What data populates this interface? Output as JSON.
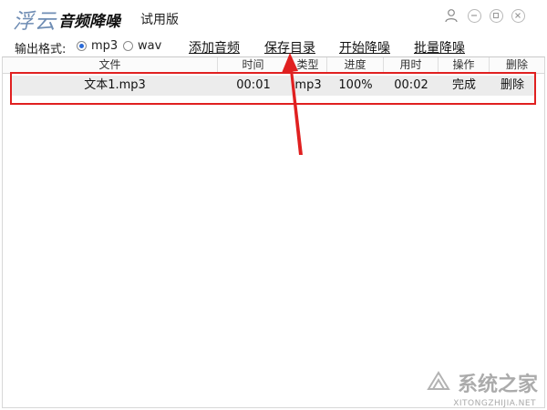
{
  "titlebar": {
    "brand": "浮云",
    "app_name": "音频降噪",
    "edition": "试用版",
    "icons": [
      "user-icon",
      "minimize-icon",
      "restore-icon",
      "close-icon"
    ]
  },
  "toolbar": {
    "format_label": "输出格式:",
    "formats": [
      {
        "label": "mp3",
        "checked": true
      },
      {
        "label": "wav",
        "checked": false
      }
    ],
    "actions": {
      "add_audio": "添加音频",
      "save_dir": "保存目录",
      "start_denoise": "开始降噪",
      "batch_denoise": "批量降噪"
    }
  },
  "table": {
    "headers": [
      "文件",
      "时间",
      "类型",
      "进度",
      "用时",
      "操作",
      "删除"
    ],
    "rows": [
      {
        "file": "文本1.mp3",
        "time": "00:01",
        "type": "mp3",
        "progress": "100%",
        "elapsed": "00:02",
        "action": "完成",
        "delete": "删除"
      }
    ]
  },
  "colors": {
    "brand": "#6f8db4",
    "annotation_red": "#e02020",
    "radio_checked": "#2a6ad8"
  },
  "watermark": {
    "text": "系统之家",
    "sub": "XITONGZHIJIA.NET"
  }
}
